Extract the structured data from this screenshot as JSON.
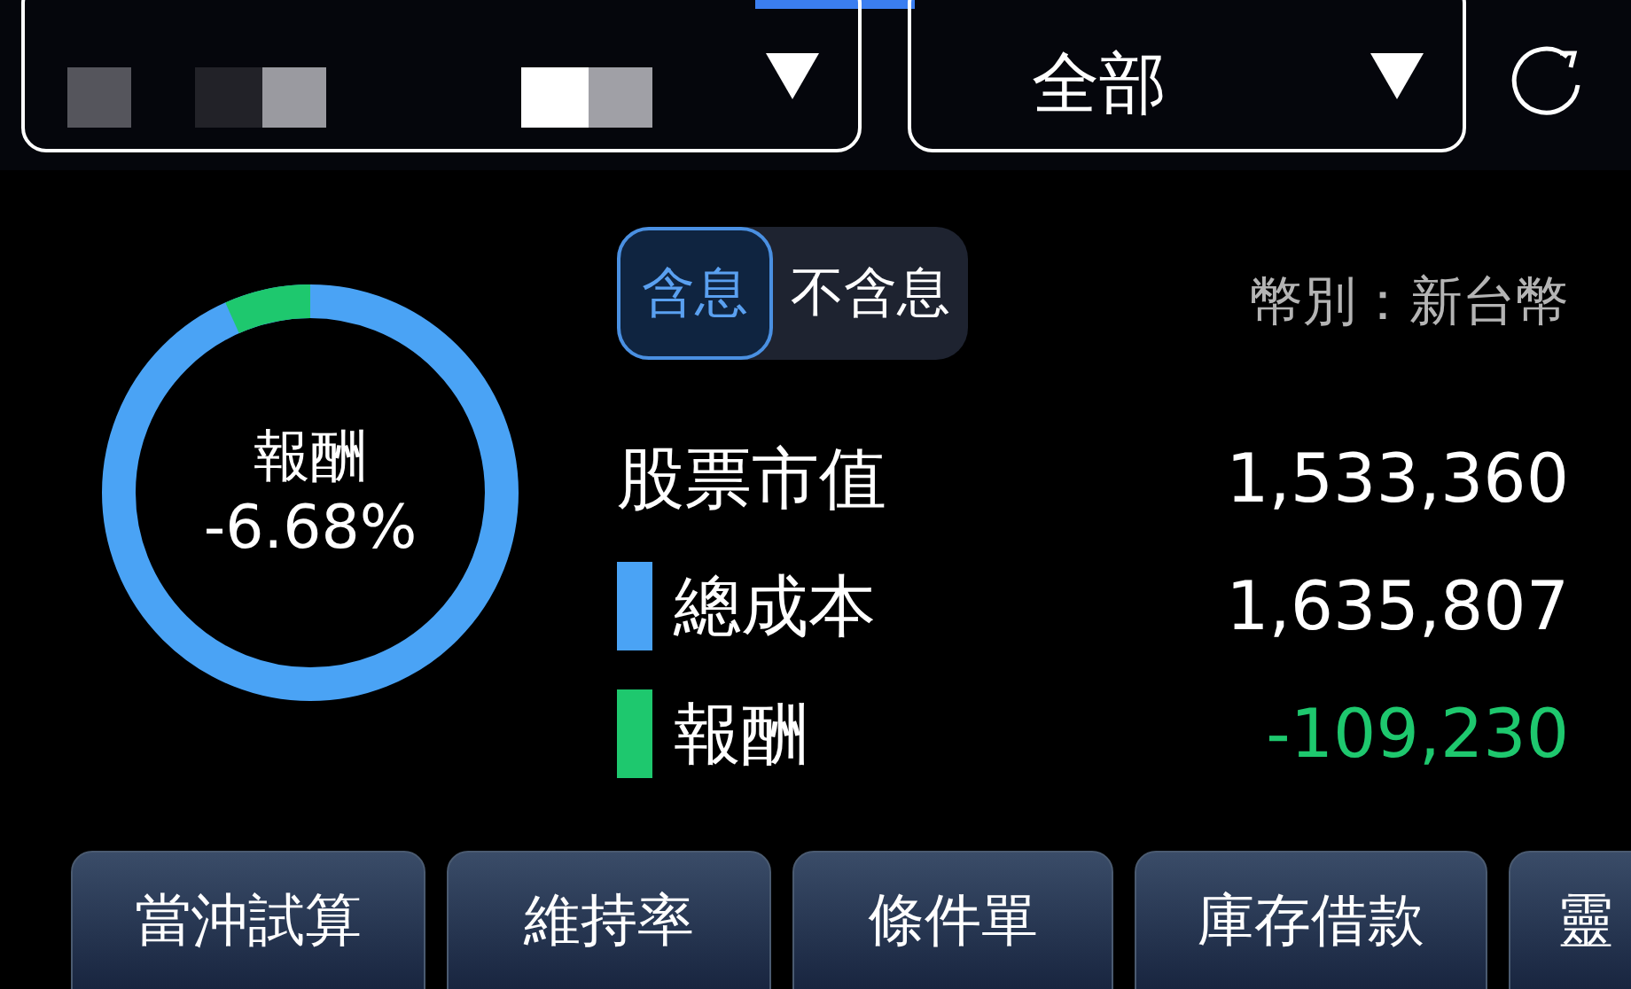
{
  "header": {
    "account_selector": {
      "redacted": true
    },
    "filter_selector": {
      "value": "全部"
    }
  },
  "summary": {
    "donut": {
      "label": "報酬",
      "value": "-6.68%",
      "level": 0.0668
    },
    "dividend_toggle": [
      {
        "label": "含息",
        "selected": true
      },
      {
        "label": "不含息",
        "selected": false
      }
    ],
    "currency": "幣別：新台幣",
    "rows": [
      {
        "label": "股票市值",
        "value": "1,533,360"
      },
      {
        "label": "總成本",
        "value": "1,635,807",
        "color": "#4aa3f5"
      },
      {
        "label": "報酬",
        "value": "-109,230",
        "color": "#1ec86e"
      }
    ]
  },
  "actions": [
    "當沖試算",
    "維持率",
    "條件單",
    "庫存借款",
    "靈"
  ]
}
